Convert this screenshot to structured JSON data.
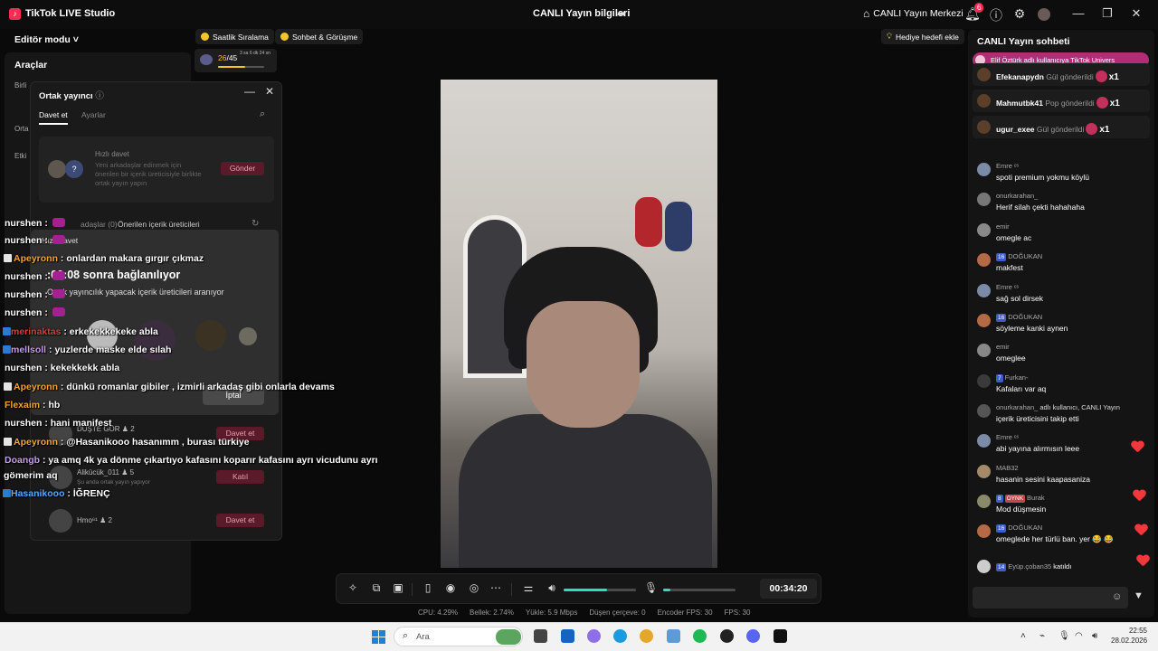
{
  "titlebar": {
    "app_name": "TikTok LIVE Studio",
    "stream_info": "CANLI Yayın bilgileri",
    "live_center": "CANLI Yayın Merkezi",
    "notification_count": "6"
  },
  "sidebar": {
    "editor_mode": "Editör modu",
    "tools_title": "Araçlar",
    "fragments": [
      "Birli",
      "Orta",
      "Etki"
    ]
  },
  "top_pills": {
    "hourly_ranking": "Saatlik Sıralama",
    "chat_meet": "Sohbet & Görüşme",
    "gift_goal": "Hediye hedefi ekle"
  },
  "hourly": {
    "progress_current": "26",
    "progress_total": "/45",
    "time_left": "3 sa 6 dk 24 sn",
    "progress_fraction": 0.58
  },
  "cohost_popup": {
    "title": "Ortak yayıncı",
    "tab_invite": "Davet et",
    "tab_settings": "Ayarlar",
    "quick_title": "Hızlı davet",
    "quick_desc": "Yeni arkadaşlar edinmek için önerilen bir içerik üreticisiyle birlikte ortak yayın yapın",
    "quick_send": "Gönder",
    "friends_tab": "adaşlar (0)",
    "suggested_tab": "Önerilen içerik üreticileri",
    "rows": [
      {
        "name": "DÜŞTE GÖR",
        "count": "2",
        "sub": "",
        "button": "Davet et"
      },
      {
        "name": "Alikücük_011",
        "count": "5",
        "sub": "Şu anda ortak yayın yapıyor",
        "button": "Katıl"
      },
      {
        "name": "Hmo⁶¹",
        "count": "2",
        "sub": "",
        "button": "Davet et"
      }
    ]
  },
  "connection_card": {
    "title": "Hızlı davet",
    "timer": ":00:08 sonra bağlanılıyor",
    "desc": "Ortak yayıncılık yapacak içerik üreticileri aranıyor",
    "cancel": "İptal"
  },
  "overlay_chat": [
    {
      "user": "nurshen",
      "sep": " : ",
      "text": "",
      "color": "#ffffff",
      "badge": "gift"
    },
    {
      "user": "nurshen",
      "sep": " : ",
      "text": "",
      "color": "#ffffff",
      "badge": "gift"
    },
    {
      "user": "Apeyronn",
      "sep": " : ",
      "text": "onlardan makara gırgır çıkmaz",
      "color": "#f0a53a",
      "badge": "box"
    },
    {
      "user": "nurshen",
      "sep": " : ",
      "text": "",
      "color": "#ffffff",
      "badge": "gift"
    },
    {
      "user": "nurshen",
      "sep": " : ",
      "text": "",
      "color": "#ffffff",
      "badge": "gift"
    },
    {
      "user": "nurshen",
      "sep": " : ",
      "text": "",
      "color": "#ffffff",
      "badge": "gift"
    },
    {
      "user": "merinaktas",
      "sep": " : ",
      "text": "erkekekkekeke abla",
      "color": "#e23a3a",
      "badge": "blue"
    },
    {
      "user": "mellsoll",
      "sep": " : ",
      "text": "yuzlerde maske elde sılah",
      "color": "#c59de8",
      "badge": "blue2"
    },
    {
      "user": "nurshen",
      "sep": " : ",
      "text": "kekekkekk abla",
      "color": "#ffffff",
      "badge": ""
    },
    {
      "user": "Apeyronn",
      "sep": " : ",
      "text": "dünkü romanlar gibiler , izmirli arkadaş gibi onlarla devams",
      "color": "#f0a53a",
      "badge": "box"
    },
    {
      "user": "Flexaim",
      "sep": " : ",
      "text": "hb",
      "color": "#f0a53a",
      "badge": ""
    },
    {
      "user": "nurshen",
      "sep": " : ",
      "text": "hani manifest",
      "color": "#ffffff",
      "badge": ""
    },
    {
      "user": "Apeyronn",
      "sep": " : ",
      "text": "@Hasanikooo hasanımm , burası türkiye",
      "color": "#f0a53a",
      "badge": "box"
    },
    {
      "user": "Doangb",
      "sep": " : ",
      "text": "ya amq 4k ya dönme çıkartıyo kafasını koparır kafasını ayrı vicudunu ayrı",
      "color": "#c59de8",
      "badge": ""
    },
    {
      "user": "",
      "sep": "",
      "text": "gömerim aq",
      "color": "#ffffff",
      "badge": ""
    },
    {
      "user": "Hasanikooo",
      "sep": " : ",
      "text": "İĞRENÇ",
      "color": "#5aa9ff",
      "badge": "blue"
    }
  ],
  "toolbar": {
    "timer": "00:34:20",
    "volume_level": 0.6,
    "mic_level": 0.1
  },
  "stats": {
    "cpu": "CPU:  4.29%",
    "memory": "Bellek:  2.74%",
    "upload": "Yükle:  5.9 Mbps",
    "dropped": "Düşen çerçeve:  0",
    "encoder_fps": "Encoder FPS:  30",
    "fps": "FPS:  30"
  },
  "live_chat": {
    "title": "CANLI Yayın sohbeti",
    "banner": "Elif Öztürk adlı kullanıcıya TikTok Univers",
    "gifts": [
      {
        "user": "Efekanapydn",
        "action": "Gül gönderildi",
        "count": "x1"
      },
      {
        "user": "Mahmutbk41",
        "action": "Pop gönderildi",
        "count": "x1"
      },
      {
        "user": "ugur_exee",
        "action": "Gül gönderildi",
        "count": "x1"
      }
    ],
    "messages": [
      {
        "name": "Emre ᵋˢ",
        "level": "",
        "text": "spoti premium yokmu köylü"
      },
      {
        "name": "onurkarahan_",
        "level": "",
        "text": "Herif silah çekti hahahaha"
      },
      {
        "name": "emir",
        "level": "",
        "text": "omegle ac"
      },
      {
        "name": "DOĞUKAN",
        "level": "16",
        "text": "makfest"
      },
      {
        "name": "Emre ᵋˢ",
        "level": "",
        "text": "sağ sol dirsek"
      },
      {
        "name": "DOĞUKAN",
        "level": "16",
        "text": "söyleme kanki aynen"
      },
      {
        "name": "emir",
        "level": "",
        "text": "omeglee"
      },
      {
        "name": "Furkan-",
        "level": "7",
        "text": "Kafaları var aq"
      },
      {
        "name": "onurkarahan_",
        "level": "",
        "text": "adlı kullanıcı, CANLI Yayın",
        "text2": "içerik üreticisini takip etti"
      },
      {
        "name": "Emre ᵋˢ",
        "level": "",
        "text": "abi yayına alırmısın leee"
      },
      {
        "name": "MAB32",
        "level": "",
        "text": "hasanin sesini kaapasaniza"
      },
      {
        "name": "Burak",
        "level": "8",
        "badge2": "OYNK",
        "text": "Mod düşmesin"
      },
      {
        "name": "DOĞUKAN",
        "level": "16",
        "text": "omeglede her türlü ban. yer 😂 😂"
      },
      {
        "name": "Eyüp.çoban35",
        "level": "14",
        "text": "katıldı"
      }
    ]
  },
  "taskbar": {
    "search_placeholder": "Ara",
    "time": "22:55",
    "date": "28.02.2026"
  }
}
